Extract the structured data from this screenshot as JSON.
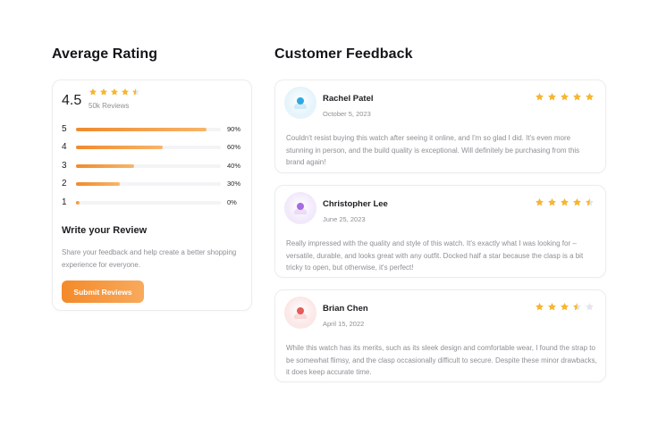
{
  "colors": {
    "accent": "#f39a3a",
    "star": "#f5b631",
    "star_empty": "#e6e6ea"
  },
  "average": {
    "title": "Average Rating",
    "score": "4.5",
    "stars": 4.5,
    "count": "50k Reviews",
    "bars": [
      {
        "label": "5",
        "pct": "90%",
        "value": 0.9
      },
      {
        "label": "4",
        "pct": "60%",
        "value": 0.6
      },
      {
        "label": "3",
        "pct": "40%",
        "value": 0.4
      },
      {
        "label": "2",
        "pct": "30%",
        "value": 0.3
      },
      {
        "label": "1",
        "pct": "0%",
        "value": 0.0
      }
    ],
    "write_title": "Write your Review",
    "write_desc": "Share your feedback and help create a better shopping experience for everyone.",
    "submit_label": "Submit Reviews"
  },
  "feedback": {
    "title": "Customer Feedback",
    "reviews": [
      {
        "name": "Rachel Patel",
        "date": "October 5, 2023",
        "rating": 5,
        "avatar_color": "#2fa8e0",
        "avatar_bg": "#e4f3fb",
        "text": "Couldn't resist buying this watch after seeing it online, and I'm so glad I did. It's even more stunning in person, and the build quality is exceptional. Will definitely be purchasing from this brand again!"
      },
      {
        "name": "Christopher Lee",
        "date": "June 25, 2023",
        "rating": 4.5,
        "avatar_color": "#a66ce0",
        "avatar_bg": "#f1e8fb",
        "text": "Really impressed with the quality and style of this watch. It's exactly what I was looking for – versatile, durable, and looks great with any outfit. Docked half a star because the clasp is a bit tricky to open, but otherwise, it's perfect!"
      },
      {
        "name": "Brian Chen",
        "date": "April 15, 2022",
        "rating": 3.5,
        "avatar_color": "#e35b5b",
        "avatar_bg": "#fbe6e6",
        "text": "While this watch has its merits, such as its sleek design and comfortable wear, I found the strap to be somewhat flimsy, and the clasp occasionally difficult to secure. Despite these minor drawbacks, it does keep accurate time."
      }
    ]
  }
}
